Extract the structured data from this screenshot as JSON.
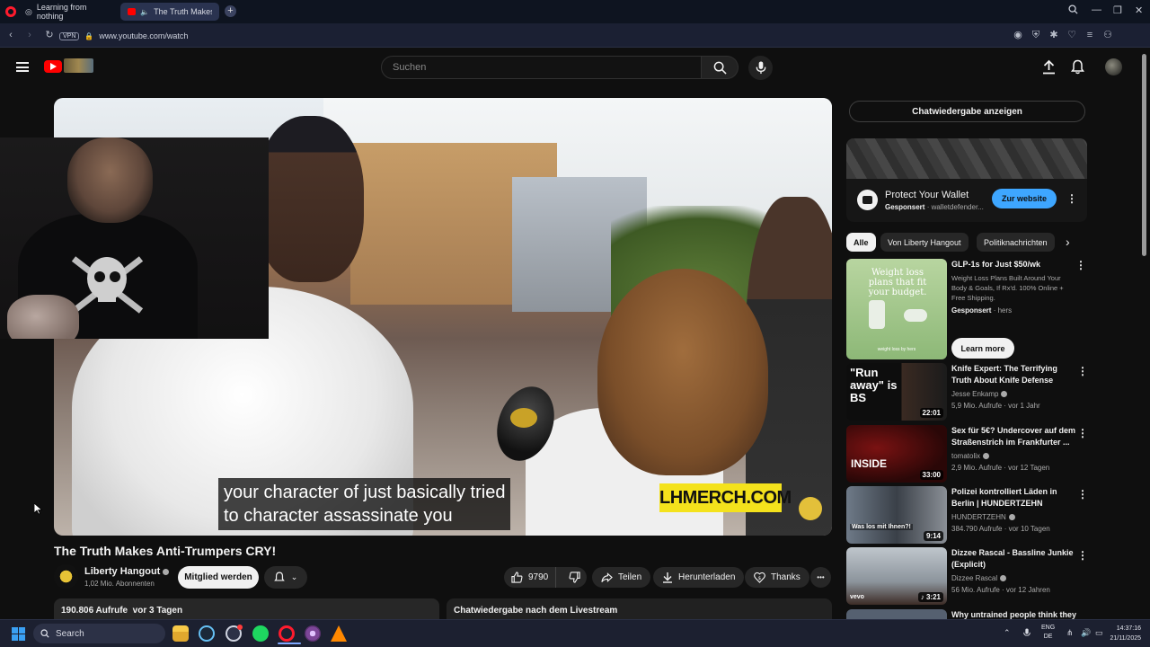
{
  "browser": {
    "tabs": [
      {
        "label": "Learning from nothing"
      },
      {
        "label": "The Truth Makes Anti-"
      }
    ],
    "vpn_label": "VPN",
    "url": "www.youtube.com/watch"
  },
  "header": {
    "search_placeholder": "Suchen"
  },
  "video": {
    "subtitle_line1": "your character of just basically tried",
    "subtitle_line2": "to character assassinate you",
    "merch_text": "LHMERCH.COM",
    "title": "The Truth Makes Anti-Trumpers CRY!"
  },
  "channel": {
    "name": "Liberty Hangout",
    "subscribers": "1,02 Mio. Abonnenten",
    "join_label": "Mitglied werden"
  },
  "actions": {
    "likes": "9790",
    "share": "Teilen",
    "download": "Herunterladen",
    "thanks": "Thanks",
    "more": "•••"
  },
  "description": {
    "stats": "190.806 Aufrufe  vor 3 Tagen",
    "livechat": "Chatwiedergabe nach dem Livestream"
  },
  "sidebar": {
    "chat_replay": "Chatwiedergabe anzeigen",
    "ad": {
      "title": "Protect Your Wallet",
      "sponsored": "Gesponsert",
      "domain": " · walletdefender...",
      "cta": "Zur website"
    },
    "chips": [
      "Alle",
      "Von Liberty Hangout",
      "Politiknachrichten"
    ],
    "recs": [
      {
        "title": "GLP-1s for Just $50/wk",
        "desc": "Weight Loss Plans Built Around Your Body & Goals, If Rx'd. 100% Online + Free Shipping.",
        "sponsored": "Gesponsert",
        "advertiser": " · hers",
        "cta": "Learn more",
        "thumb_text": "Weight loss plans that fit your budget.",
        "thumb_footer": "weight loss by hers"
      },
      {
        "title": "Knife Expert: The Terrifying Truth About Knife Defense",
        "channel": "Jesse Enkamp",
        "meta": "5,9 Mio. Aufrufe · vor 1 Jahr",
        "duration": "22:01",
        "thumb_text": "\"Run away\" is BS"
      },
      {
        "title": "Sex für 5€? Undercover auf dem Straßenstrich im Frankfurter ...",
        "channel": "tomatolix",
        "meta": "2,9 Mio. Aufrufe · vor 12 Tagen",
        "duration": "33:00",
        "thumb_text": "INSIDE"
      },
      {
        "title": "Polizei kontrolliert Läden in Berlin | HUNDERTZEHN",
        "channel": "HUNDERTZEHN",
        "meta": "384.790 Aufrufe · vor 10 Tagen",
        "duration": "9:14",
        "thumb_text": "Was los mit Ihnen?!"
      },
      {
        "title": "Dizzee Rascal - Bassline Junkie (Explicit)",
        "channel": "Dizzee Rascal",
        "meta": "56 Mio. Aufrufe · vor 12 Jahren",
        "duration": "3:21",
        "thumb_text": "vevo"
      },
      {
        "title": "Why untrained people think they"
      }
    ]
  },
  "taskbar": {
    "search_label": "Search",
    "lang_top": "ENG",
    "lang_bottom": "DE",
    "time": "14:37:16",
    "date": "21/11/2025"
  },
  "colors": {
    "yt_red": "#ff0000",
    "cta_blue": "#3ea6ff",
    "merch_yellow": "#f4e21c"
  }
}
